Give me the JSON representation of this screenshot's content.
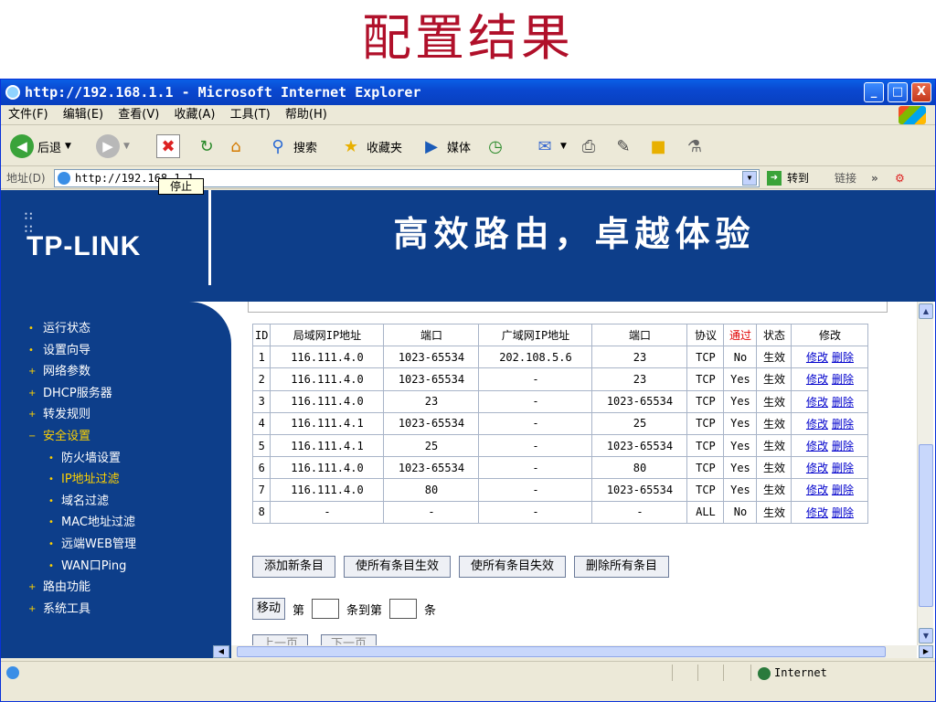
{
  "slide": {
    "title": "配置结果"
  },
  "window": {
    "title": "http://192.168.1.1 - Microsoft Internet Explorer",
    "min": "_",
    "max": "□",
    "close": "X"
  },
  "menu": [
    "文件(F)",
    "编辑(E)",
    "查看(V)",
    "收藏(A)",
    "工具(T)",
    "帮助(H)"
  ],
  "toolbar": {
    "back": "后退",
    "stop_tooltip": "停止",
    "search": "搜索",
    "favorites": "收藏夹",
    "media": "媒体"
  },
  "address": {
    "label": "地址(D)",
    "value": "http://192.168.1.1",
    "go": "转到",
    "links": "链接"
  },
  "banner": {
    "logo": "TP-LINK",
    "slogan": "高效路由，卓越体验"
  },
  "sidebar": [
    {
      "label": "运行状态",
      "level": 0
    },
    {
      "label": "设置向导",
      "level": 0
    },
    {
      "label": "网络参数",
      "level": 0
    },
    {
      "label": "DHCP服务器",
      "level": 0
    },
    {
      "label": "转发规则",
      "level": 0
    },
    {
      "label": "安全设置",
      "level": 0,
      "open": true
    },
    {
      "label": "防火墙设置",
      "level": 1
    },
    {
      "label": "IP地址过滤",
      "level": 1,
      "active": true
    },
    {
      "label": "域名过滤",
      "level": 1
    },
    {
      "label": "MAC地址过滤",
      "level": 1
    },
    {
      "label": "远端WEB管理",
      "level": 1
    },
    {
      "label": "WAN口Ping",
      "level": 1
    },
    {
      "label": "路由功能",
      "level": 0
    },
    {
      "label": "系统工具",
      "level": 0
    }
  ],
  "table": {
    "headers": [
      "ID",
      "局域网IP地址",
      "端口",
      "广域网IP地址",
      "端口",
      "协议",
      "通过",
      "状态",
      "修改"
    ],
    "rows": [
      [
        "1",
        "116.111.4.0",
        "1023-65534",
        "202.108.5.6",
        "23",
        "TCP",
        "No",
        "生效"
      ],
      [
        "2",
        "116.111.4.0",
        "1023-65534",
        "-",
        "23",
        "TCP",
        "Yes",
        "生效"
      ],
      [
        "3",
        "116.111.4.0",
        "23",
        "-",
        "1023-65534",
        "TCP",
        "Yes",
        "生效"
      ],
      [
        "4",
        "116.111.4.1",
        "1023-65534",
        "-",
        "25",
        "TCP",
        "Yes",
        "生效"
      ],
      [
        "5",
        "116.111.4.1",
        "25",
        "-",
        "1023-65534",
        "TCP",
        "Yes",
        "生效"
      ],
      [
        "6",
        "116.111.4.0",
        "1023-65534",
        "-",
        "80",
        "TCP",
        "Yes",
        "生效"
      ],
      [
        "7",
        "116.111.4.0",
        "80",
        "-",
        "1023-65534",
        "TCP",
        "Yes",
        "生效"
      ],
      [
        "8",
        "-",
        "-",
        "-",
        "-",
        "ALL",
        "No",
        "生效"
      ]
    ],
    "edit_label": "修改",
    "delete_label": "删除"
  },
  "buttons": {
    "add": "添加新条目",
    "enable_all": "使所有条目生效",
    "disable_all": "使所有条目失效",
    "delete_all": "删除所有条目"
  },
  "move": {
    "button": "移动",
    "prefix": "第",
    "middle": "条到第",
    "suffix": "条"
  },
  "pager": {
    "prev": "上一页",
    "next": "下一页"
  },
  "status": {
    "zone": "Internet"
  }
}
